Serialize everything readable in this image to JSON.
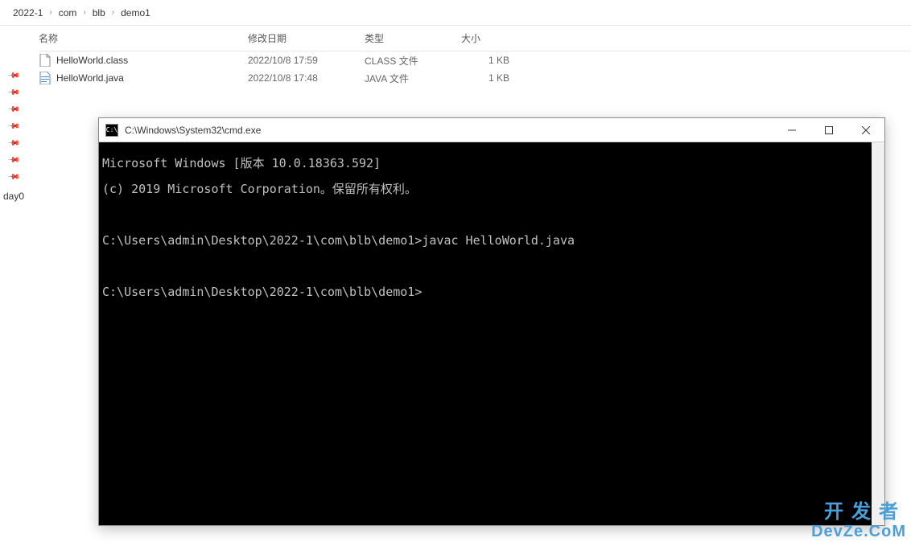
{
  "breadcrumb": {
    "items": [
      "2022-1",
      "com",
      "blb",
      "demo1"
    ]
  },
  "sidebar": {
    "truncated_label": "day0"
  },
  "columns": {
    "name": "名称",
    "date": "修改日期",
    "type": "类型",
    "size": "大小"
  },
  "files": [
    {
      "name": "HelloWorld.class",
      "date": "2022/10/8 17:59",
      "type": "CLASS 文件",
      "size": "1 KB",
      "icon": "file"
    },
    {
      "name": "HelloWorld.java",
      "date": "2022/10/8 17:48",
      "type": "JAVA 文件",
      "size": "1 KB",
      "icon": "java"
    }
  ],
  "cmd": {
    "title": "C:\\Windows\\System32\\cmd.exe",
    "icon_text": "C:\\",
    "lines": [
      "Microsoft Windows [版本 10.0.18363.592]",
      "(c) 2019 Microsoft Corporation。保留所有权利。",
      "",
      "C:\\Users\\admin\\Desktop\\2022-1\\com\\blb\\demo1>javac HelloWorld.java",
      "",
      "C:\\Users\\admin\\Desktop\\2022-1\\com\\blb\\demo1>"
    ]
  },
  "watermark": {
    "line1": "开发者",
    "line2": "DevZe.CoM"
  }
}
